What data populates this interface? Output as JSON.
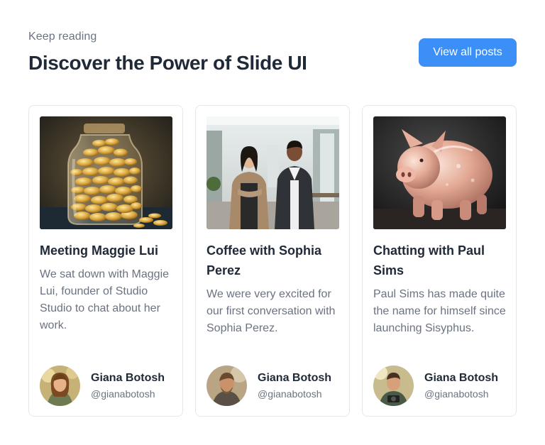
{
  "header": {
    "eyebrow": "Keep reading",
    "title": "Discover the Power of Slide UI",
    "view_all_label": "View all posts"
  },
  "posts": [
    {
      "title": "Meeting Maggie Lui",
      "description": "We sat down with Maggie Lui, founder of Studio Studio to chat about her work.",
      "image": "jar-of-coins-image",
      "author": {
        "name": "Giana Botosh",
        "handle": "@gianabotosh"
      }
    },
    {
      "title": "Coffee with Sophia Perez",
      "description": "We were very excited for our first conversation with Sophia Perez.",
      "image": "two-people-office-image",
      "author": {
        "name": "Giana Botosh",
        "handle": "@gianabotosh"
      }
    },
    {
      "title": "Chatting with Paul Sims",
      "description": "Paul Sims has made quite the name for himself since launching Sisyphus.",
      "image": "glass-piggy-bank-image",
      "author": {
        "name": "Giana Botosh",
        "handle": "@gianabotosh"
      }
    }
  ],
  "colors": {
    "accent": "#3b8ff6",
    "text_primary": "#1f2937",
    "text_secondary": "#6b7280",
    "card_border": "#e5e7eb"
  }
}
